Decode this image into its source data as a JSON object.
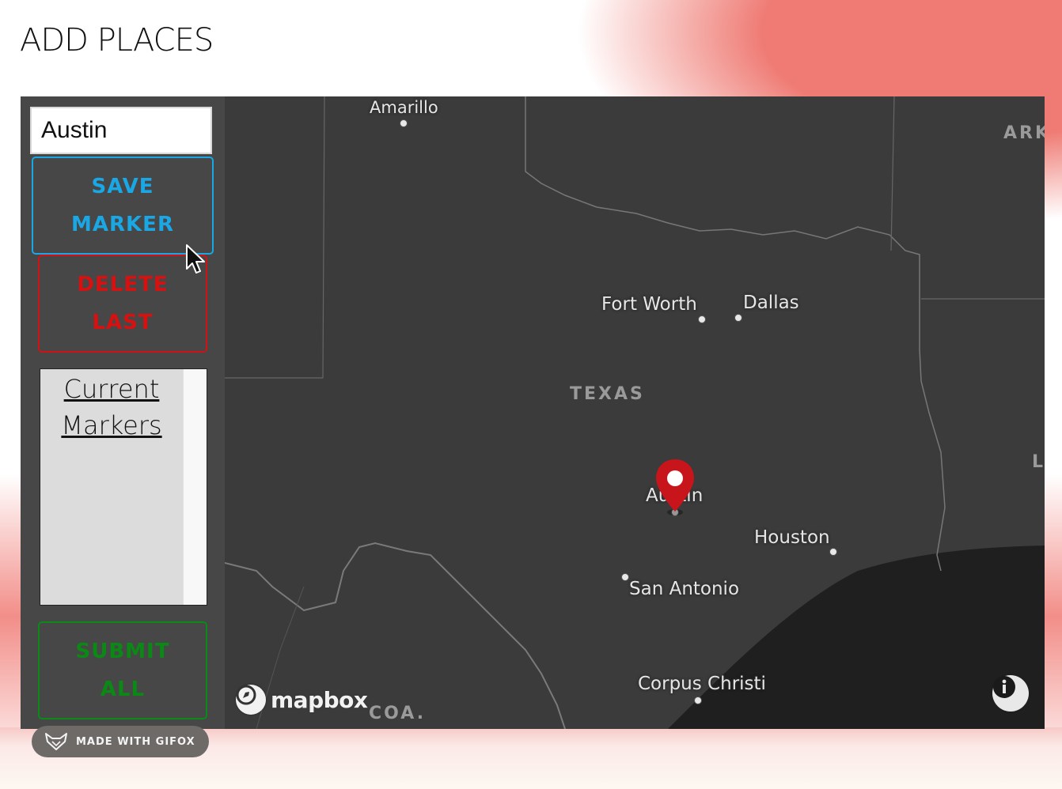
{
  "page": {
    "title": "ADD PLACES"
  },
  "sidebar": {
    "search_value": "Austin",
    "save_label": "SAVE\nMARKER",
    "delete_label": "DELETE\nLAST",
    "markers_heading": "Current\nMarkers",
    "submit_label": "SUBMIT\nALL"
  },
  "map": {
    "cities": {
      "amarillo": "Amarillo",
      "fort_worth": "Fort Worth",
      "dallas": "Dallas",
      "austin": "Austin",
      "houston": "Houston",
      "san_antonio": "San Antonio",
      "corpus_christi": "Corpus Christi"
    },
    "regions": {
      "texas": "TEXAS",
      "ark": "ARK",
      "la": "LA",
      "coa": "COA."
    },
    "logo_text": "mapbox",
    "marker_color": "#c8141b"
  },
  "badge": {
    "label": "MADE WITH GIFOX"
  },
  "colors": {
    "save": "#1aa7e6",
    "delete": "#d81010",
    "submit": "#0a8a14",
    "map_bg": "#3b3b3b",
    "water": "#1f1f1f"
  }
}
